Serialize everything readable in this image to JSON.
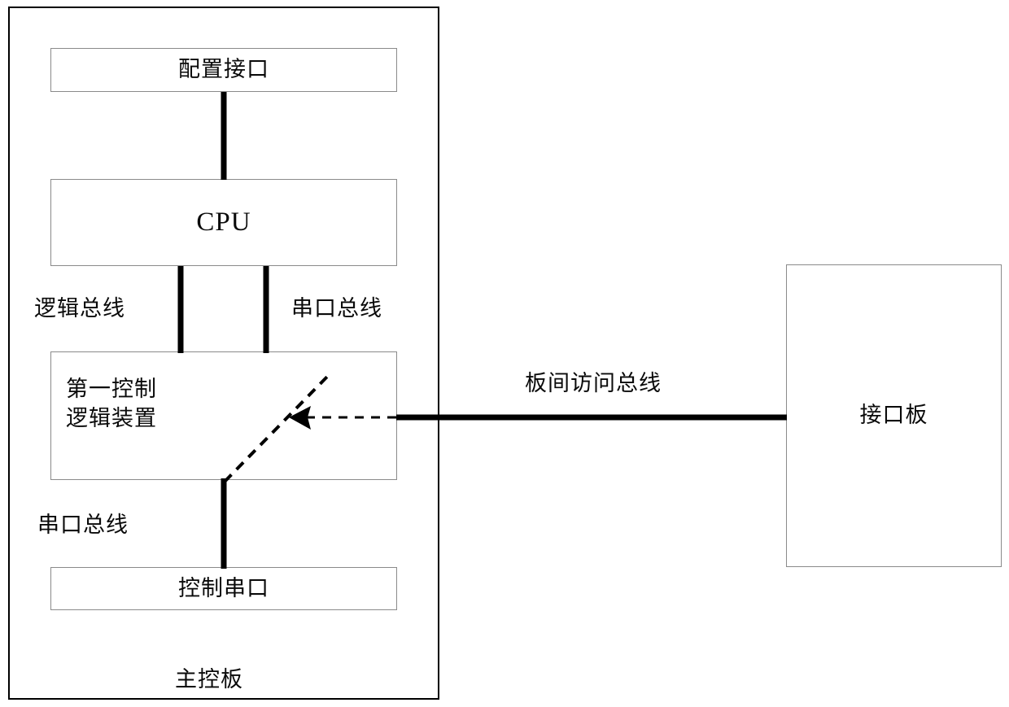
{
  "diagram": {
    "type": "block-diagram",
    "description": "Main control board and interface board block diagram",
    "boards": {
      "main_board": {
        "label": "主控板",
        "label_position": "bottom-center"
      },
      "interface_board": {
        "label": "接口板",
        "label_position": "center"
      }
    },
    "blocks": [
      {
        "id": "config-interface",
        "label": "配置接口"
      },
      {
        "id": "cpu",
        "label": "CPU"
      },
      {
        "id": "first-control-logic",
        "label": "第一控制\n逻辑装置"
      },
      {
        "id": "control-serial-port",
        "label": "控制串口"
      }
    ],
    "bus_labels": {
      "logic_bus": "逻辑总线",
      "serial_bus_top": "串口总线",
      "serial_bus_bottom": "串口总线",
      "inter_board_bus": "板间访问总线"
    },
    "connections": [
      {
        "from": "config-interface",
        "to": "cpu",
        "style": "solid-thick"
      },
      {
        "from": "cpu",
        "to": "first-control-logic",
        "style": "solid-thick",
        "bus": "逻辑总线"
      },
      {
        "from": "cpu",
        "to": "first-control-logic",
        "style": "solid-thick",
        "bus": "串口总线"
      },
      {
        "from": "first-control-logic",
        "to": "control-serial-port",
        "style": "solid-thick",
        "bus": "串口总线"
      },
      {
        "from": "interface-board",
        "to": "first-control-logic",
        "style": "solid-thick-then-dashed-arrow",
        "bus": "板间访问总线"
      }
    ],
    "colors": {
      "stroke": "#000000",
      "box_border": "#8a8a8a",
      "background": "#ffffff",
      "text": "#0a0a0a"
    }
  }
}
